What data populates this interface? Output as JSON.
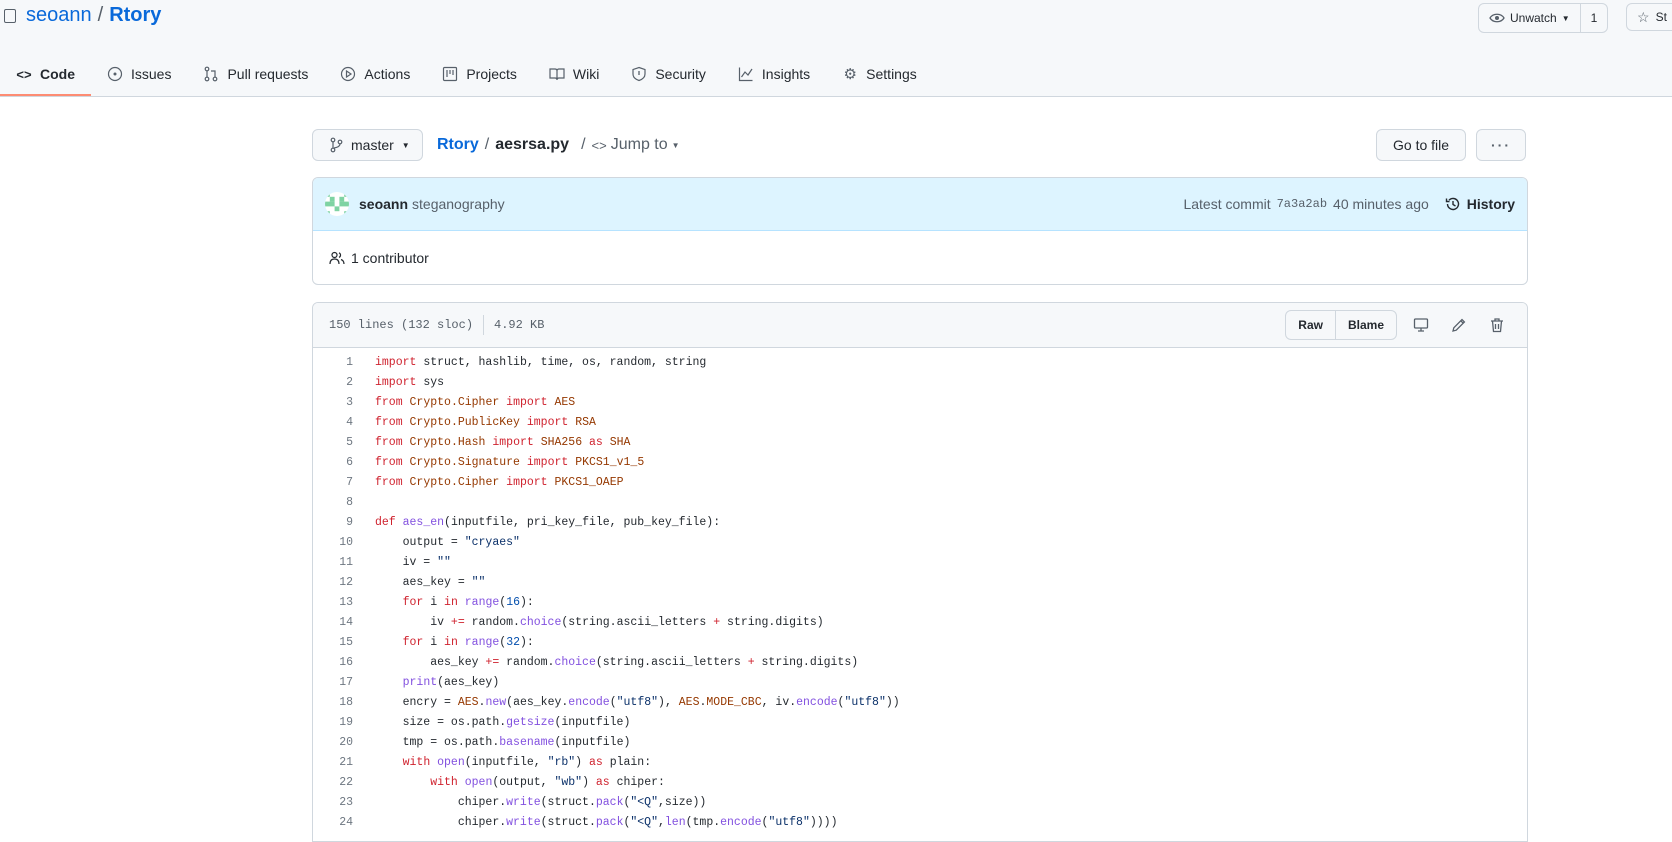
{
  "repo": {
    "owner": "seoann",
    "separator": "/",
    "name": "Rtory"
  },
  "watch": {
    "label": "Unwatch",
    "count": "1"
  },
  "star": {
    "label": "St"
  },
  "tabs": [
    {
      "label": "Code",
      "icon": "code-icon",
      "active": true
    },
    {
      "label": "Issues",
      "icon": "issue-icon"
    },
    {
      "label": "Pull requests",
      "icon": "pull-request-icon"
    },
    {
      "label": "Actions",
      "icon": "play-icon"
    },
    {
      "label": "Projects",
      "icon": "project-icon"
    },
    {
      "label": "Wiki",
      "icon": "book-icon"
    },
    {
      "label": "Security",
      "icon": "shield-icon"
    },
    {
      "label": "Insights",
      "icon": "graph-icon"
    },
    {
      "label": "Settings",
      "icon": "gear-icon"
    }
  ],
  "branch": {
    "label": "master"
  },
  "breadcrumb": {
    "repo": "Rtory",
    "sep": "/",
    "file": "aesrsa.py",
    "sep2": "/",
    "jump": "Jump to"
  },
  "goto_file": "Go to file",
  "more_label": "···",
  "commit": {
    "author": "seoann",
    "message": "steganography",
    "latest_label": "Latest commit",
    "sha": "7a3a2ab",
    "time": "40 minutes ago",
    "history": "History"
  },
  "contributors": "1 contributor",
  "file_info": {
    "lines": "150 lines (132 sloc)",
    "size": "4.92 KB"
  },
  "file_buttons": {
    "raw": "Raw",
    "blame": "Blame"
  },
  "code_lines": [
    {
      "n": "1",
      "t": "import struct, hashlib, time, os, random, string"
    },
    {
      "n": "2",
      "t": "import sys"
    },
    {
      "n": "3",
      "t": "from Crypto.Cipher import AES"
    },
    {
      "n": "4",
      "t": "from Crypto.PublicKey import RSA"
    },
    {
      "n": "5",
      "t": "from Crypto.Hash import SHA256 as SHA"
    },
    {
      "n": "6",
      "t": "from Crypto.Signature import PKCS1_v1_5"
    },
    {
      "n": "7",
      "t": "from Crypto.Cipher import PKCS1_OAEP"
    },
    {
      "n": "8",
      "t": ""
    },
    {
      "n": "9",
      "t": "def aes_en(inputfile, pri_key_file, pub_key_file):"
    },
    {
      "n": "10",
      "t": "    output = \"cryaes\""
    },
    {
      "n": "11",
      "t": "    iv = \"\""
    },
    {
      "n": "12",
      "t": "    aes_key = \"\""
    },
    {
      "n": "13",
      "t": "    for i in range(16):"
    },
    {
      "n": "14",
      "t": "        iv += random.choice(string.ascii_letters + string.digits)"
    },
    {
      "n": "15",
      "t": "    for i in range(32):"
    },
    {
      "n": "16",
      "t": "        aes_key += random.choice(string.ascii_letters + string.digits)"
    },
    {
      "n": "17",
      "t": "    print(aes_key)"
    },
    {
      "n": "18",
      "t": "    encry = AES.new(aes_key.encode(\"utf8\"), AES.MODE_CBC, iv.encode(\"utf8\"))"
    },
    {
      "n": "19",
      "t": "    size = os.path.getsize(inputfile)"
    },
    {
      "n": "20",
      "t": "    tmp = os.path.basename(inputfile)"
    },
    {
      "n": "21",
      "t": "    with open(inputfile, \"rb\") as plain:"
    },
    {
      "n": "22",
      "t": "        with open(output, \"wb\") as chiper:"
    },
    {
      "n": "23",
      "t": "            chiper.write(struct.pack(\"<Q\",size))"
    },
    {
      "n": "24",
      "t": "            chiper.write(struct.pack(\"<Q\",len(tmp.encode(\"utf8\"))))"
    }
  ],
  "colors": {
    "accent": "#0969da",
    "tab_underline": "#fd8c73",
    "keyword": "#cf222e",
    "module": "#953800",
    "function": "#8250df",
    "string": "#0a3069"
  }
}
